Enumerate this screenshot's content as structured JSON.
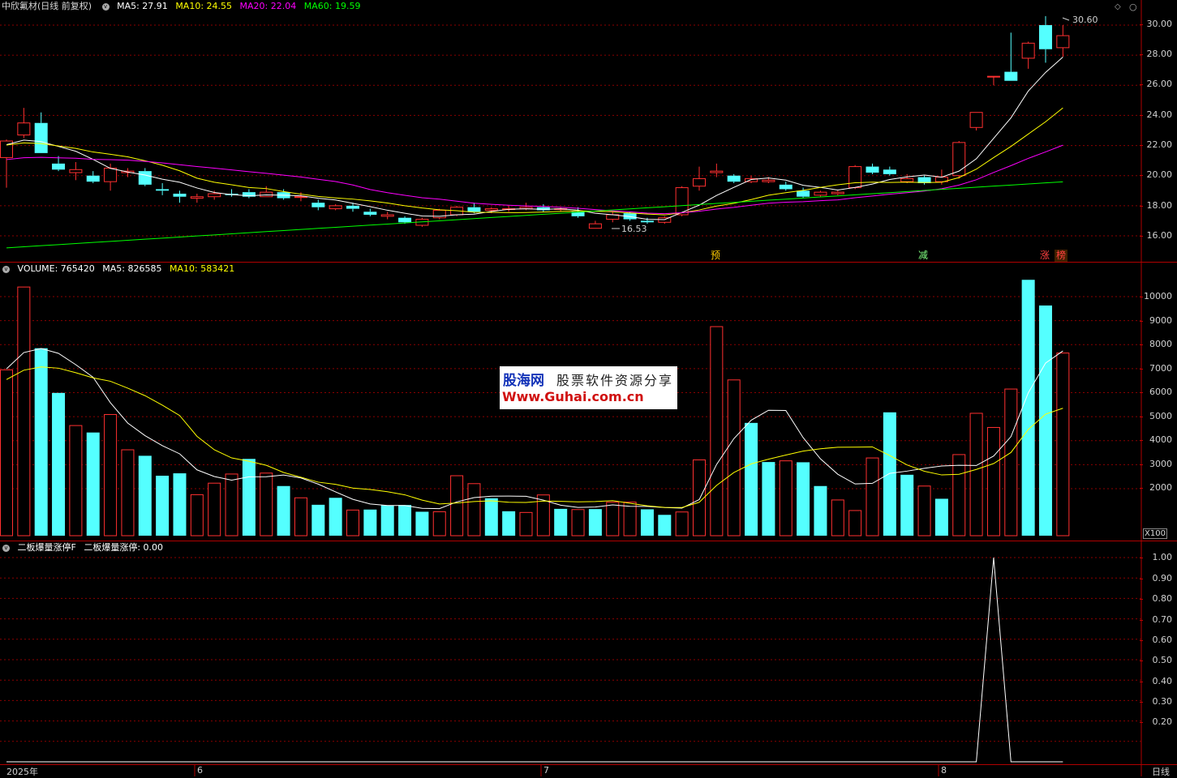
{
  "header": {
    "stock_title": "中欣氟材(日线 前复权)",
    "ma5": "MA5: 27.91",
    "ma10": "MA10: 24.55",
    "ma20": "MA20: 22.04",
    "ma60": "MA60: 19.59"
  },
  "volume_header": {
    "label": "VOLUME: 765420",
    "ma5": "MA5: 826585",
    "ma10": "MA10: 583421"
  },
  "indicator_header": {
    "name": "二板爆量涨停F",
    "value": "二板爆量涨停: 0.00"
  },
  "price_axis": [
    "30.00",
    "28.00",
    "26.00",
    "24.00",
    "22.00",
    "20.00",
    "18.00",
    "16.00"
  ],
  "volume_axis": [
    "10000",
    "9000",
    "8000",
    "7000",
    "6000",
    "5000",
    "4000",
    "3000",
    "2000"
  ],
  "volume_unit": "X100",
  "indicator_axis": [
    "1.00",
    "0.90",
    "0.80",
    "0.70",
    "0.60",
    "0.50",
    "0.40",
    "0.30",
    "0.20"
  ],
  "annotations": {
    "high": "30.60",
    "low": "16.53"
  },
  "signals": {
    "s1": "预",
    "s2": "减",
    "s3": "涨",
    "s4": "榜"
  },
  "dates": {
    "d1": "2025年",
    "d2": "6",
    "d3": "7",
    "d4": "8"
  },
  "period": "日线",
  "watermark": {
    "brand": "股海网",
    "slogan": "股票软件资源分享",
    "url": "Www.Guhai.com.cn"
  },
  "colors": {
    "up": "#ff3030",
    "down": "#54ffff",
    "ma5": "#ffffff",
    "ma10": "#ffff00",
    "ma20": "#ff00ff",
    "ma60": "#00ff00",
    "grid": "#8b0000",
    "bg": "#000000"
  },
  "candles": [
    [
      21.2,
      22.3,
      22.4,
      19.2
    ],
    [
      22.7,
      23.5,
      24.5,
      22.5
    ],
    [
      23.5,
      21.5,
      24.2,
      21.5
    ],
    [
      20.8,
      20.4,
      21.3,
      20.3
    ],
    [
      20.2,
      20.4,
      20.9,
      19.7
    ],
    [
      20.0,
      19.6,
      20.3,
      19.5
    ],
    [
      19.6,
      20.5,
      20.8,
      19.0
    ],
    [
      20.2,
      20.3,
      20.5,
      19.9
    ],
    [
      20.3,
      19.4,
      20.5,
      19.3
    ],
    [
      19.1,
      19.0,
      19.5,
      18.7
    ],
    [
      18.8,
      18.6,
      19.0,
      18.2
    ],
    [
      18.5,
      18.6,
      18.8,
      18.2
    ],
    [
      18.6,
      18.8,
      19.0,
      18.4
    ],
    [
      18.8,
      18.7,
      19.1,
      18.6
    ],
    [
      18.9,
      18.6,
      19.1,
      18.5
    ],
    [
      18.6,
      18.9,
      19.3,
      18.6
    ],
    [
      18.9,
      18.5,
      19.1,
      18.4
    ],
    [
      18.6,
      18.6,
      18.9,
      18.3
    ],
    [
      18.2,
      17.9,
      18.4,
      17.7
    ],
    [
      17.8,
      18.0,
      18.1,
      17.7
    ],
    [
      18.0,
      17.8,
      18.2,
      17.6
    ],
    [
      17.6,
      17.4,
      17.8,
      17.3
    ],
    [
      17.3,
      17.4,
      17.6,
      17.1
    ],
    [
      17.2,
      16.9,
      17.3,
      16.8
    ],
    [
      16.7,
      17.1,
      17.2,
      16.6
    ],
    [
      17.2,
      17.7,
      17.8,
      17.1
    ],
    [
      17.4,
      17.9,
      18.0,
      17.3
    ],
    [
      17.9,
      17.6,
      18.2,
      17.5
    ],
    [
      17.7,
      17.8,
      17.9,
      17.5
    ],
    [
      17.8,
      17.8,
      18.0,
      17.6
    ],
    [
      17.8,
      17.9,
      18.2,
      17.7
    ],
    [
      17.9,
      17.7,
      18.1,
      17.6
    ],
    [
      17.8,
      17.8,
      17.9,
      17.6
    ],
    [
      17.6,
      17.3,
      17.9,
      17.2
    ],
    [
      16.5,
      16.8,
      17.0,
      16.5
    ],
    [
      17.1,
      17.4,
      17.6,
      16.9
    ],
    [
      17.5,
      17.1,
      17.6,
      17.0
    ],
    [
      17.0,
      16.9,
      17.2,
      16.8
    ],
    [
      16.9,
      17.2,
      17.3,
      16.8
    ],
    [
      17.4,
      19.2,
      19.3,
      17.3
    ],
    [
      19.3,
      19.8,
      20.6,
      19.0
    ],
    [
      20.2,
      20.3,
      20.8,
      19.9
    ],
    [
      20.0,
      19.6,
      20.1,
      19.5
    ],
    [
      19.6,
      19.8,
      20.0,
      19.5
    ],
    [
      19.6,
      19.7,
      19.9,
      19.5
    ],
    [
      19.4,
      19.1,
      19.6,
      19.0
    ],
    [
      19.0,
      18.6,
      19.2,
      18.5
    ],
    [
      18.7,
      18.9,
      19.0,
      18.6
    ],
    [
      18.8,
      18.9,
      19.0,
      18.7
    ],
    [
      19.2,
      20.6,
      20.7,
      19.1
    ],
    [
      20.6,
      20.2,
      20.8,
      20.1
    ],
    [
      20.4,
      20.1,
      20.6,
      20.0
    ],
    [
      19.6,
      19.8,
      20.1,
      19.5
    ],
    [
      19.9,
      19.5,
      20.0,
      19.4
    ],
    [
      19.6,
      19.9,
      20.4,
      19.4
    ],
    [
      20.0,
      22.2,
      22.3,
      19.8
    ],
    [
      23.2,
      24.2,
      24.2,
      23.0
    ],
    [
      26.6,
      26.6,
      26.6,
      26.0
    ],
    [
      26.9,
      26.3,
      29.5,
      26.3
    ],
    [
      27.8,
      28.8,
      28.9,
      27.1
    ],
    [
      30.0,
      28.4,
      30.6,
      27.5
    ],
    [
      28.5,
      29.3,
      30.0,
      27.9
    ]
  ],
  "volumes": [
    [
      69.5,
      1
    ],
    [
      104,
      1
    ],
    [
      78.5,
      0
    ],
    [
      59.9,
      0
    ],
    [
      46.3,
      1
    ],
    [
      43.4,
      0
    ],
    [
      50.9,
      1
    ],
    [
      36.2,
      1
    ],
    [
      33.7,
      0
    ],
    [
      25.4,
      0
    ],
    [
      26.4,
      0
    ],
    [
      17.5,
      1
    ],
    [
      22.3,
      1
    ],
    [
      26.1,
      1
    ],
    [
      32.4,
      0
    ],
    [
      26.5,
      1
    ],
    [
      21.1,
      0
    ],
    [
      16.2,
      1
    ],
    [
      13.3,
      0
    ],
    [
      16.2,
      0
    ],
    [
      11.1,
      1
    ],
    [
      11.3,
      0
    ],
    [
      13.1,
      0
    ],
    [
      13.2,
      0
    ],
    [
      10.4,
      0
    ],
    [
      10.4,
      1
    ],
    [
      25.4,
      1
    ],
    [
      22.1,
      1
    ],
    [
      16.0,
      0
    ],
    [
      10.6,
      0
    ],
    [
      10.1,
      1
    ],
    [
      17.4,
      1
    ],
    [
      11.6,
      0
    ],
    [
      11.3,
      1
    ],
    [
      11.5,
      0
    ],
    [
      14.4,
      1
    ],
    [
      14.4,
      1
    ],
    [
      11.4,
      0
    ],
    [
      9.1,
      0
    ],
    [
      10.3,
      1
    ],
    [
      32.0,
      1
    ],
    [
      87.5,
      1
    ],
    [
      65.3,
      1
    ],
    [
      47.4,
      0
    ],
    [
      31.1,
      0
    ],
    [
      31.6,
      1
    ],
    [
      31.0,
      0
    ],
    [
      21.1,
      0
    ],
    [
      15.3,
      1
    ],
    [
      10.9,
      1
    ],
    [
      32.8,
      1
    ],
    [
      51.8,
      0
    ],
    [
      25.8,
      0
    ],
    [
      21.1,
      1
    ],
    [
      15.8,
      0
    ],
    [
      34.2,
      1
    ],
    [
      51.4,
      1
    ],
    [
      45.5,
      1
    ],
    [
      61.5,
      1
    ],
    [
      107,
      0
    ],
    [
      96.3,
      0
    ],
    [
      76.5,
      1
    ]
  ],
  "indicator_spike_index": 57
}
